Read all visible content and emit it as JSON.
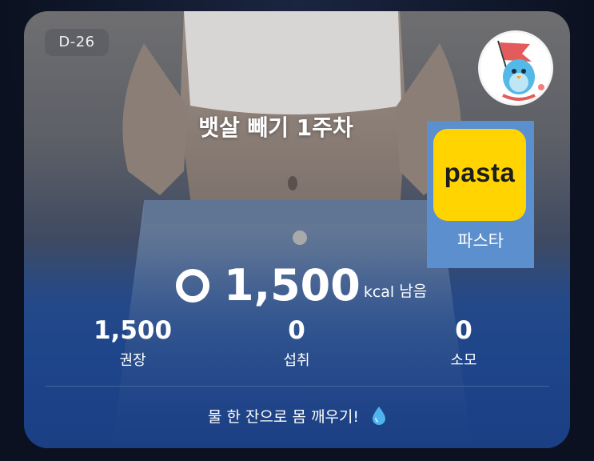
{
  "card": {
    "dday": "D-26",
    "title": "뱃살 빼기 1주차"
  },
  "ad": {
    "brand": "pasta",
    "label": "파스타",
    "brand_color": "#ffd400",
    "box_color": "#5b8fce"
  },
  "calories": {
    "remaining_value": "1,500",
    "unit": "kcal",
    "suffix": "남음"
  },
  "stats": [
    {
      "value": "1,500",
      "label": "권장"
    },
    {
      "value": "0",
      "label": "섭취"
    },
    {
      "value": "0",
      "label": "소모"
    }
  ],
  "message": {
    "text": "물 한 잔으로 몸 깨우기!",
    "icon": "water-drop-icon"
  },
  "avatar": {
    "icon": "mascot-flag-icon"
  }
}
